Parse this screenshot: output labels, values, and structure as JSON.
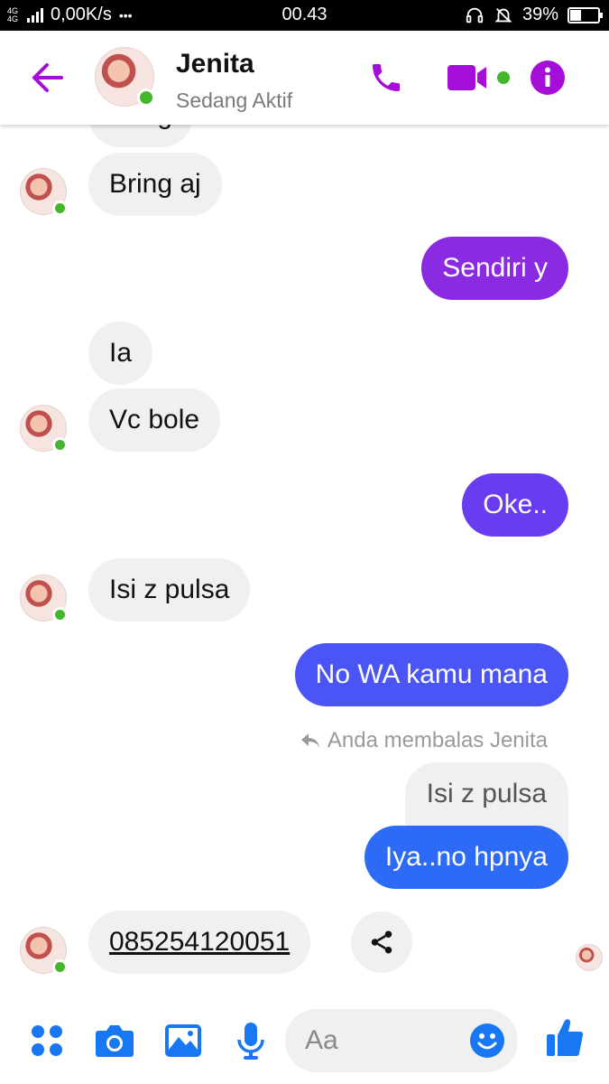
{
  "status_bar": {
    "network": "4G 4G",
    "speed": "0,00K/s",
    "dots": "•••",
    "time": "00.43",
    "battery": "39%",
    "battery_level": 0.39
  },
  "header": {
    "name": "Jenita",
    "status": "Sedang Aktif"
  },
  "messages": {
    "partial": "Bring",
    "m1": "Bring aj",
    "m2": "Sendiri y",
    "m3": "Ia",
    "m4": "Vc bole",
    "m5": "Oke..",
    "m6": "Isi z pulsa",
    "m7": "No WA kamu mana",
    "reply_note": "Anda membalas Jenita",
    "quoted": "Isi z pulsa",
    "m8": "Iya..no hpnya",
    "m9": "085254120051"
  },
  "composer": {
    "placeholder": "Aa"
  },
  "colors": {
    "accent": "#a50dd8",
    "sent_1": "#8a2be2",
    "sent_2": "#6a3cf0",
    "sent_3": "#4b55f5",
    "sent_4": "#2d6bf7",
    "composer_icon": "#1877f2",
    "online": "#42b72a"
  }
}
